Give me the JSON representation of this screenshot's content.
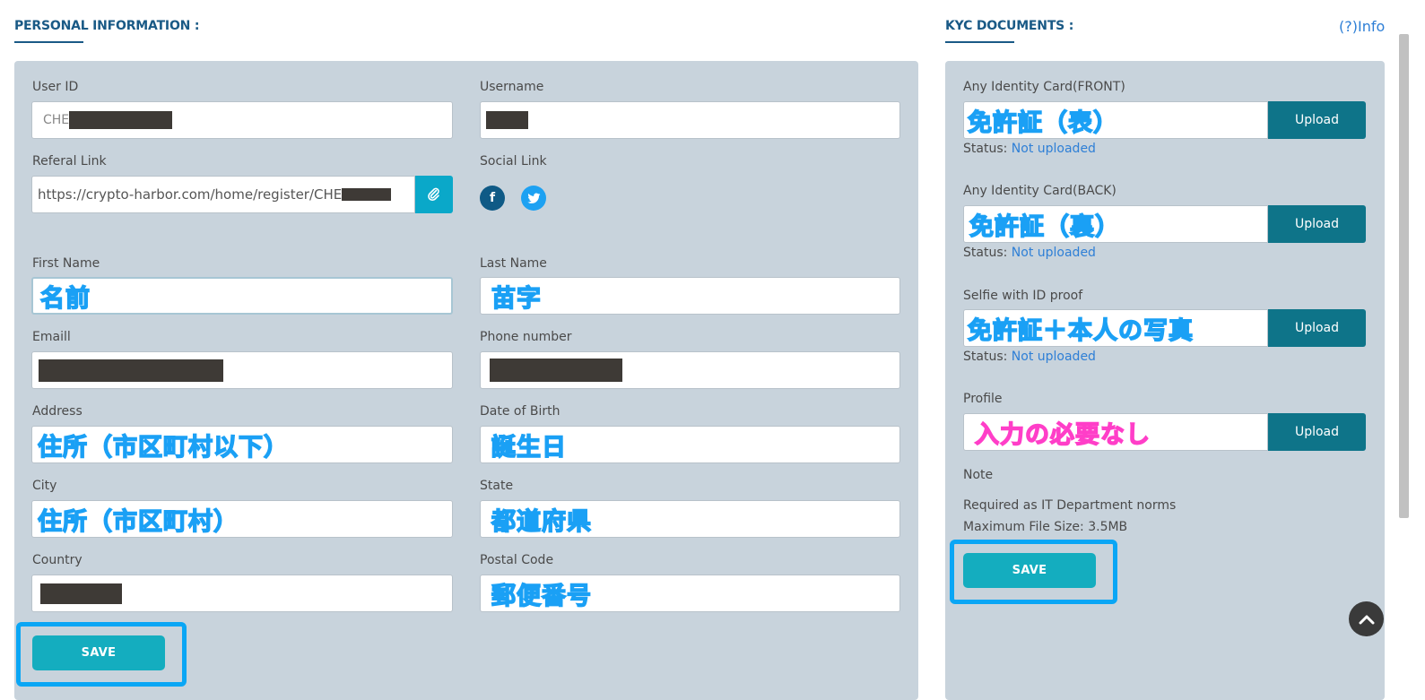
{
  "personal": {
    "title": "PERSONAL INFORMATION :",
    "user_id_label": "User ID",
    "user_id_value": "CHE",
    "username_label": "Username",
    "referral_label": "Referal Link",
    "referral_value": "https://crypto-harbor.com/home/register/CHE",
    "social_label": "Social Link",
    "social_facebook": "f",
    "first_name_label": "First Name",
    "first_name_value": "名前",
    "last_name_label": "Last Name",
    "last_name_value": "苗字",
    "email_label": "Emaill",
    "phone_label": "Phone number",
    "address_label": "Address",
    "address_value": "住所（市区町村以下）",
    "dob_label": "Date of Birth",
    "dob_value": "誕生日",
    "city_label": "City",
    "city_value": "住所（市区町村）",
    "state_label": "State",
    "state_value": "都道府県",
    "country_label": "Country",
    "postal_label": "Postal Code",
    "postal_value": "郵便番号",
    "save_label": "SAVE"
  },
  "kyc": {
    "title": "KYC DOCUMENTS :",
    "info_label": "(?)Info",
    "front_label": "Any Identity Card(FRONT)",
    "front_value": "免許証（表）",
    "back_label": "Any Identity Card(BACK)",
    "back_value": "免許証（裏）",
    "selfie_label": "Selfie with ID proof",
    "selfie_value": "免許証＋本人の写真",
    "profile_label": "Profile",
    "profile_value": "入力の必要なし",
    "upload_label": "Upload",
    "status_prefix": "Status:",
    "status_value": "Not uploaded",
    "note_label": "Note",
    "note_line1": "Required as IT Department norms",
    "note_line2": "Maximum File Size: 3.5MB",
    "save_label": "SAVE"
  },
  "colors": {
    "accent": "#14adbf",
    "highlight": "#0aa6f5",
    "annotation_blue": "#1aa0f5",
    "annotation_pink": "#ff3ec8",
    "upload": "#0e7489",
    "panel": "#c8d3dc"
  }
}
